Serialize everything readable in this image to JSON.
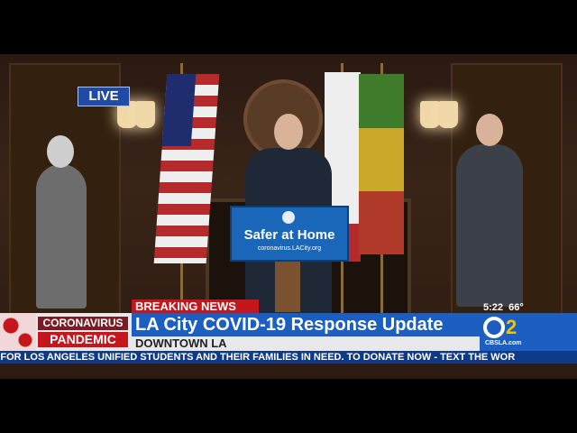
{
  "live_label": "LIVE",
  "podium": {
    "main": "Safer at Home",
    "url": "coronavirus.LACity.org"
  },
  "lower_third": {
    "breaking": "BREAKING NEWS",
    "headline": "LA City COVID-19 Response Update",
    "subheadline": "DOWNTOWN LA",
    "bug_line1": "CORONAVIRUS",
    "bug_line2": "PANDEMIC",
    "time": "5:22",
    "temp": "66°"
  },
  "station": {
    "number": "2",
    "url": "CBSLA.com"
  },
  "ticker": "E FOR LOS ANGELES UNIFIED STUDENTS AND THEIR FAMILIES IN NEED. TO DONATE NOW - TEXT THE WOR",
  "colors": {
    "breaking_red": "#c4161c",
    "brand_blue": "#1c5fc0",
    "ticker_blue": "#0f3a8a",
    "accent_gold": "#f0c400"
  },
  "icons": [
    "cbs-eye-logo",
    "virus-icon",
    "city-seal"
  ]
}
